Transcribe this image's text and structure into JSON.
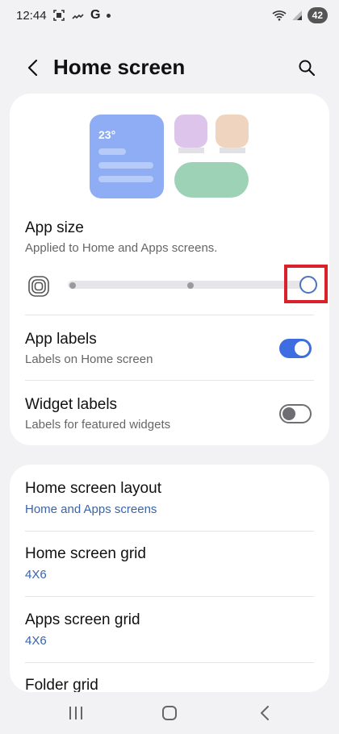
{
  "status_bar": {
    "time": "12:44",
    "google_letter": "G",
    "battery": "42",
    "notification_icons": [
      "screenshot-icon",
      "missed-call-icon",
      "google-icon",
      "dot-icon"
    ],
    "system_icons": [
      "wifi-icon",
      "signal-icon",
      "battery-icon"
    ]
  },
  "header": {
    "title": "Home screen",
    "back_icon": "chevron-left-icon",
    "search_icon": "search-icon"
  },
  "preview": {
    "temperature": "23°",
    "colors": {
      "big_widget": "#8fadf4",
      "app_purple": "#dcc4ea",
      "app_peach": "#efd5c0",
      "pill_widget": "#9ed2b7"
    }
  },
  "app_size": {
    "title": "App size",
    "subtitle": "Applied to Home and Apps screens.",
    "icon": "app-size-icon",
    "levels": 3,
    "selected_level": 3
  },
  "app_labels": {
    "title": "App labels",
    "subtitle": "Labels on Home screen",
    "enabled": true
  },
  "widget_labels": {
    "title": "Widget labels",
    "subtitle": "Labels for featured widgets",
    "enabled": false
  },
  "settings_list": [
    {
      "title": "Home screen layout",
      "value": "Home and Apps screens"
    },
    {
      "title": "Home screen grid",
      "value": "4X6"
    },
    {
      "title": "Apps screen grid",
      "value": "4X6"
    },
    {
      "title": "Folder grid",
      "value": ""
    }
  ],
  "nav_bar": {
    "recents_icon": "recents-icon",
    "home_icon": "home-icon",
    "back_icon": "back-icon"
  },
  "accent_color": "#3d6de0",
  "highlight_color": "#d9202b"
}
